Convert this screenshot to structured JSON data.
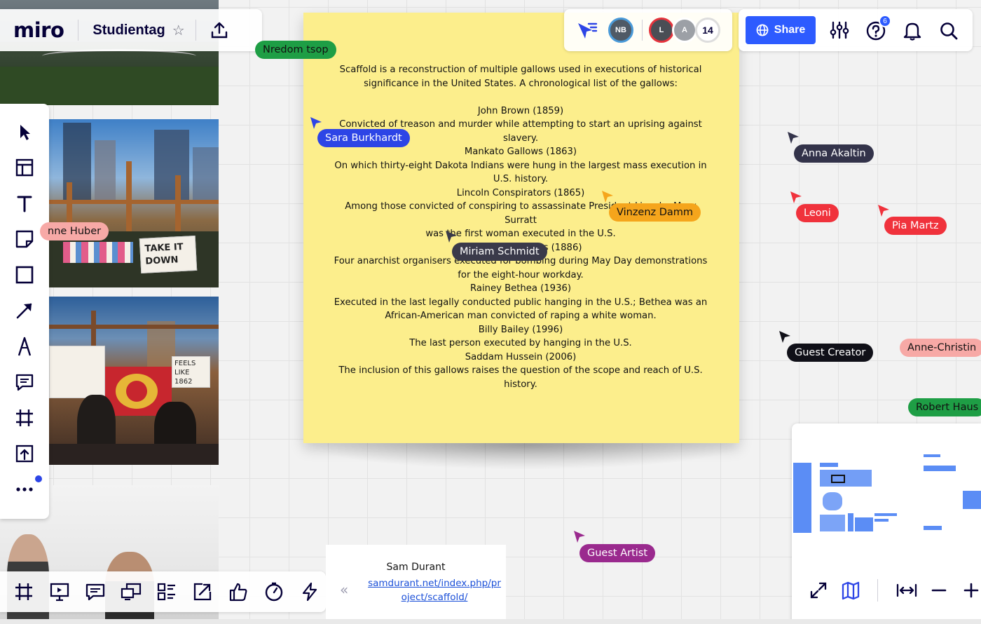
{
  "app": {
    "logo": "miro",
    "board_title": "Studientag",
    "star_glyph": "☆"
  },
  "collaborators": {
    "avatar_nb": "NB",
    "avatar_l": "L",
    "avatar_a": "A",
    "count": "14",
    "help_badge": "6"
  },
  "toolbar_right": {
    "share_label": "Share"
  },
  "sticky_note": {
    "lines": [
      "Scaffold is a reconstruction of multiple gallows used in executions of historical",
      "significance in the United States. A chronological list of the gallows:",
      "",
      "John Brown (1859)",
      "Convicted of treason and murder while attempting to start an uprising against",
      "slavery.",
      "Mankato Gallows (1863)",
      "On which thirty-eight Dakota Indians were hung in the largest mass execution in",
      "U.S. history.",
      "Lincoln Conspirators (1865)",
      "Among those convicted of conspiring to assassinate President Lincoln, Mary Surratt",
      "was the first woman executed in the U.S.",
      "Haymarket Martyrs (1886)",
      "Four anarchist organisers executed for bombing during May Day demonstrations",
      "for the eight-hour workday.",
      "Rainey Bethea (1936)",
      "Executed in the last legally conducted public hanging in the U.S.; Bethea was an",
      "African-American man convicted of raping a white woman.",
      "Billy Bailey (1996)",
      "The last person executed by hanging in the U.S.",
      "Saddam Hussein (2006)",
      "The inclusion of this gallows raises the question of the scope and reach of U.S.",
      "history."
    ]
  },
  "cursors": [
    {
      "name": "Nredom tsop",
      "color": "#1e9e45",
      "text_color": "#111111"
    },
    {
      "name": "Sara Burkhardt",
      "color": "#2d45e6",
      "text_color": "#ffffff"
    },
    {
      "name": "Vinzenz Damm",
      "color": "#f5a51c",
      "text_color": "#111111"
    },
    {
      "name": "Miriam Schmidt",
      "color": "#3a3a4a",
      "text_color": "#ffffff"
    },
    {
      "name": "Anna Akaltin",
      "color": "#33334a",
      "text_color": "#ffffff"
    },
    {
      "name": "Leoni",
      "color": "#f0323c",
      "text_color": "#ffffff"
    },
    {
      "name": "Pia Martz",
      "color": "#f0323c",
      "text_color": "#ffffff"
    },
    {
      "name": "Guest Creator",
      "color": "#101018",
      "text_color": "#ffffff"
    },
    {
      "name": "Anne-Christin",
      "color": "#f7a9a6",
      "text_color": "#111111"
    },
    {
      "name": "Robert Haus",
      "color": "#1e9e45",
      "text_color": "#111111"
    },
    {
      "name": "Guest Artist",
      "color": "#9a2a8e",
      "text_color": "#ffffff"
    },
    {
      "name": "nne Huber",
      "color": "#f7a9a6",
      "text_color": "#111111"
    }
  ],
  "photos": {
    "sign_take_down": "TAKE IT DOWN",
    "sign_feels_like": "FEELS LIKE 1862"
  },
  "link_card": {
    "title": "Sam Durant",
    "url": "samdurant.net/index.php/project/scaffold/",
    "collapse_glyph": "«"
  },
  "icons": {
    "left_toolbar": [
      "select-icon",
      "templates-icon",
      "text-icon",
      "sticky-note-icon",
      "shape-icon",
      "arrow-icon",
      "pen-icon",
      "comment-icon",
      "frame-icon",
      "upload-icon",
      "more-icon"
    ],
    "bottom_toolbar": [
      "frames-icon",
      "present-icon",
      "comments-icon",
      "screen-share-icon",
      "card-list-icon",
      "export-icon",
      "reactions-icon",
      "timer-icon",
      "lightning-icon"
    ]
  },
  "colors": {
    "accent": "#2d5bff",
    "sticky": "#fcee8c",
    "minimap": "#5b8df5"
  }
}
